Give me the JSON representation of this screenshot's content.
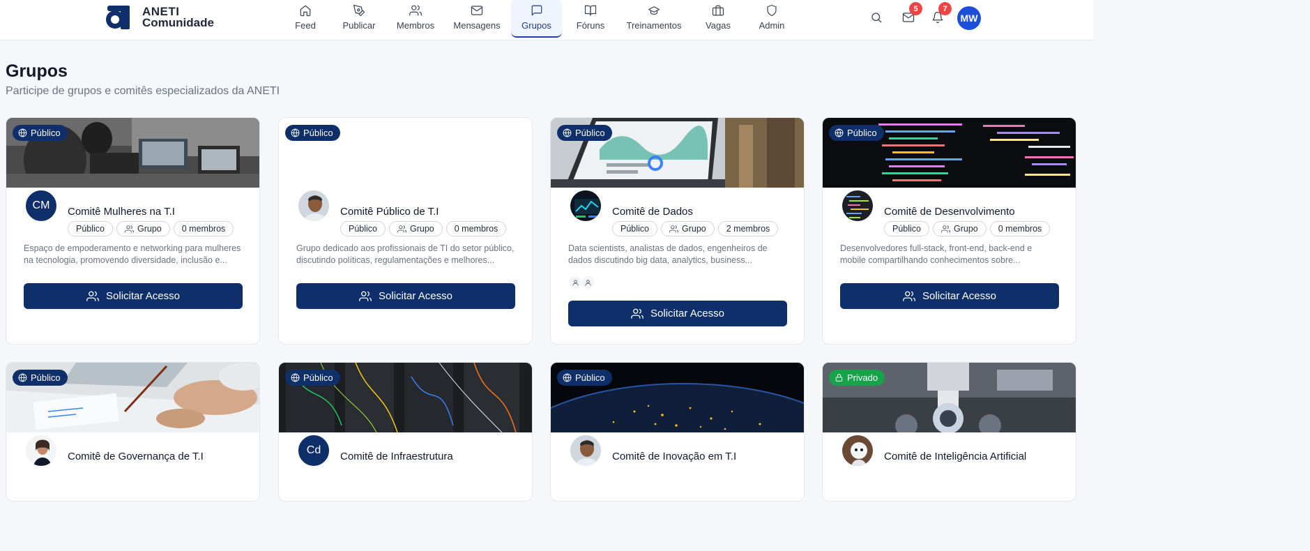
{
  "brand": {
    "line1": "ANETI",
    "line2": "Comunidade"
  },
  "nav": [
    {
      "label": "Feed",
      "icon": "home-icon"
    },
    {
      "label": "Publicar",
      "icon": "pen-icon"
    },
    {
      "label": "Membros",
      "icon": "users-icon"
    },
    {
      "label": "Mensagens",
      "icon": "mail-icon"
    },
    {
      "label": "Grupos",
      "icon": "message-square-icon",
      "active": true
    },
    {
      "label": "Fóruns",
      "icon": "book-open-icon"
    },
    {
      "label": "Treinamentos",
      "icon": "graduation-cap-icon"
    },
    {
      "label": "Vagas",
      "icon": "briefcase-icon"
    },
    {
      "label": "Admin",
      "icon": "shield-icon"
    }
  ],
  "header_right": {
    "messages_count": "5",
    "notifications_count": "7",
    "user_initials": "MW"
  },
  "page": {
    "title": "Grupos",
    "subtitle": "Participe de grupos e comitês especializados da ANETI"
  },
  "groups": [
    {
      "visibility": "Público",
      "initials": "CM",
      "avatar": "initials",
      "name": "Comitê Mulheres na T.I",
      "type": "Público",
      "kind": "Grupo",
      "members": "0 membros",
      "description_1": "Espaço de empoderamento e networking para mulheres",
      "description_2": "na tecnologia, promovendo diversidade, inclusão e...",
      "button": "Solicitar Acesso",
      "image": "people-laptops"
    },
    {
      "visibility": "Público",
      "initials": "",
      "avatar": "photo-man",
      "name": "Comitê Público de T.I",
      "type": "Público",
      "kind": "Grupo",
      "members": "0 membros",
      "description_1": "Grupo dedicado aos profissionais de TI do setor público,",
      "description_2": "discutindo políticas, regulamentações e melhores...",
      "button": "Solicitar Acesso",
      "image": "none"
    },
    {
      "visibility": "Público",
      "initials": "",
      "avatar": "photo-dark",
      "name": "Comitê de Dados",
      "type": "Público",
      "kind": "Grupo",
      "members": "2 membros",
      "description_1": "Data scientists, analistas de dados, engenheiros de",
      "description_2": "dados discutindo big data, analytics, business...",
      "button": "Solicitar Acesso",
      "image": "dashboard-laptop"
    },
    {
      "visibility": "Público",
      "initials": "",
      "avatar": "photo-code",
      "name": "Comitê de Desenvolvimento",
      "type": "Público",
      "kind": "Grupo",
      "members": "0 membros",
      "description_1": "Desenvolvedores full-stack, front-end, back-end e",
      "description_2": "mobile compartilhando conhecimentos sobre...",
      "button": "Solicitar Acesso",
      "image": "code-screen"
    }
  ],
  "groups_row2": [
    {
      "visibility": "Público",
      "name": "Comitê de Governança de T.I",
      "avatar": "photo-woman",
      "initials": ""
    },
    {
      "visibility": "Público",
      "name": "Comitê de Infraestrutura",
      "avatar": "initials",
      "initials": "Cd"
    },
    {
      "visibility": "Público",
      "name": "Comitê de Inovação em T.I",
      "avatar": "photo-man",
      "initials": ""
    },
    {
      "visibility": "Privado",
      "name": "Comitê de Inteligência Artificial",
      "avatar": "photo-robot",
      "initials": ""
    }
  ],
  "colors": {
    "primary": "#0f2f6b",
    "accent": "#1d4ed8",
    "badge": "#ef4444",
    "private": "#16a34a"
  }
}
